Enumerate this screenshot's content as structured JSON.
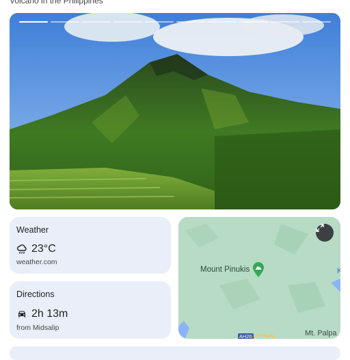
{
  "header": {
    "subtitle": "Volcano in the Philippines"
  },
  "hero": {
    "story_segments": 10,
    "active_segment": 1
  },
  "weather": {
    "title": "Weather",
    "temperature": "23°C",
    "source": "weather.com",
    "icon": "rain-cloud-icon"
  },
  "directions": {
    "title": "Directions",
    "duration": "2h 13m",
    "origin": "from Midsalip",
    "icon": "car-icon"
  },
  "map": {
    "place_label": "Mount Pinukis",
    "road_label": "AH26",
    "nearby_place": "Mt. Palpa",
    "edge_letter": "K",
    "expand_icon": "expand-icon",
    "pin_color": "#34a853"
  },
  "colors": {
    "card_bg": "#e9eef9",
    "map_bg": "#b7dbc5"
  }
}
